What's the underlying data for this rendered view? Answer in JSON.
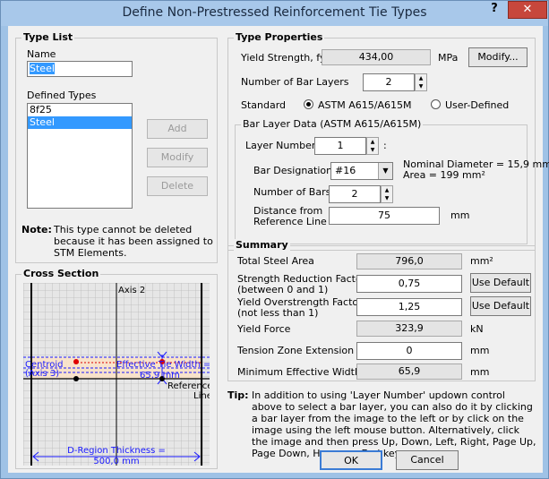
{
  "window": {
    "title": "Define Non-Prestressed Reinforcement Tie Types",
    "help": "?",
    "close": "✕"
  },
  "type_list": {
    "title": "Type List",
    "name_label": "Name",
    "name_value": "Steel",
    "defined_label": "Defined Types",
    "items": [
      "8f25",
      "Steel"
    ],
    "selected": "Steel",
    "add": "Add",
    "modify": "Modify",
    "delete": "Delete",
    "note_label": "Note:",
    "note_text": "This type cannot be deleted because it has been assigned to STM Elements."
  },
  "cross_section": {
    "title": "Cross Section",
    "axis_label": "Axis 2",
    "centroid_label": "Centroid",
    "axis3_label": "(Axis 3)",
    "eff_width_label": "Effective Tie Width =",
    "eff_width_value": "65,9 mm",
    "ref_line_label": "Reference",
    "ref_line_label2": "Line",
    "dregion_label": "D-Region Thickness =",
    "dregion_value": "500,0 mm"
  },
  "type_properties": {
    "title": "Type Properties",
    "yield_label": "Yield Strength, fy",
    "yield_value": "434,00",
    "yield_unit": "MPa",
    "modify_btn": "Modify...",
    "layers_label": "Number of Bar Layers",
    "layers_value": "2",
    "standard_label": "Standard",
    "standard_astm": "ASTM A615/A615M",
    "standard_user": "User-Defined",
    "standard_selected": "astm"
  },
  "bar_layer": {
    "title": "Bar Layer Data (ASTM A615/A615M)",
    "layer_num_label": "Layer Number",
    "layer_num_value": "1",
    "layer_num_colon": ":",
    "bar_des_label": "Bar Designation",
    "bar_des_value": "#16",
    "nominal_diam": "Nominal Diameter = 15,9 mm",
    "area": "Area = 199 mm²",
    "num_bars_label": "Number of Bars",
    "num_bars_value": "2",
    "dist_label1": "Distance from",
    "dist_label2": "Reference Line",
    "dist_value": "75",
    "dist_unit": "mm"
  },
  "summary": {
    "title": "Summary",
    "total_area_label": "Total Steel Area",
    "total_area_value": "796,0",
    "total_area_unit": "mm²",
    "srf_label1": "Strength Reduction Factor",
    "srf_label2": "(between 0 and 1)",
    "srf_value": "0,75",
    "use_default1": "Use Default",
    "yof_label1": "Yield Overstrength Factor",
    "yof_label2": "(not less than 1)",
    "yof_value": "1,25",
    "use_default2": "Use Default",
    "yield_force_label": "Yield Force",
    "yield_force_value": "323,9",
    "yield_force_unit": "kN",
    "tension_label": "Tension Zone Extension",
    "tension_value": "0",
    "tension_unit": "mm",
    "min_width_label": "Minimum Effective Width",
    "min_width_value": "65,9",
    "min_width_unit": "mm"
  },
  "tip": {
    "label": "Tip:",
    "text": "In addition to using 'Layer Number' updown control above to select a bar layer, you can also do it by clicking a bar layer from the image to the left or by click on the image using the left mouse button. Alternatively, click the image and then press Up, Down, Left, Right, Page Up, Page Down, Home, or End key."
  },
  "buttons": {
    "ok": "OK",
    "cancel": "Cancel"
  }
}
